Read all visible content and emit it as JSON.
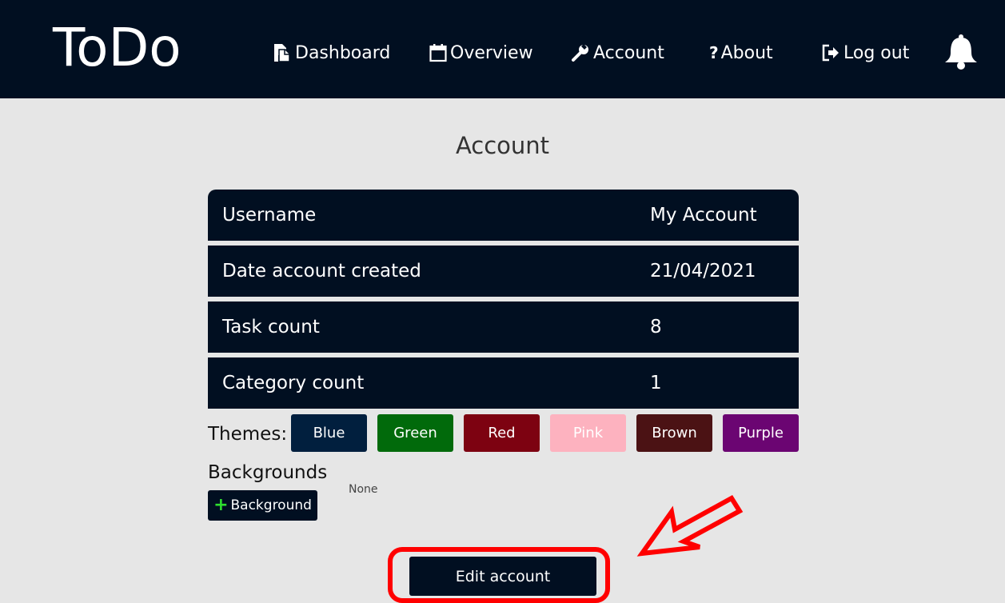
{
  "app": {
    "brand": "ToDo"
  },
  "nav": {
    "items": [
      {
        "label": "Dashboard",
        "icon": "file-copy-icon"
      },
      {
        "label": "Overview",
        "icon": "calendar-icon"
      },
      {
        "label": "Account",
        "icon": "wrench-icon"
      },
      {
        "label": "About",
        "icon": "question-icon"
      },
      {
        "label": "Log out",
        "icon": "logout-icon"
      }
    ],
    "notifications_icon": "bell-icon"
  },
  "page": {
    "title": "Account"
  },
  "account_info": {
    "rows": [
      {
        "label": "Username",
        "value": "My Account"
      },
      {
        "label": "Date account created",
        "value": "21/04/2021"
      },
      {
        "label": "Task count",
        "value": "8"
      },
      {
        "label": "Category count",
        "value": "1"
      }
    ]
  },
  "themes": {
    "label": "Themes:",
    "options": [
      {
        "label": "Blue",
        "color": "#011f3e"
      },
      {
        "label": "Green",
        "color": "#016a0b"
      },
      {
        "label": "Red",
        "color": "#7d0211"
      },
      {
        "label": "Pink",
        "color": "#fdb2bf"
      },
      {
        "label": "Brown",
        "color": "#4b1214"
      },
      {
        "label": "Purple",
        "color": "#6b0572"
      }
    ]
  },
  "backgrounds": {
    "heading": "Backgrounds",
    "empty_text": "None",
    "add_button_label": "Background",
    "add_icon": "plus-icon"
  },
  "actions": {
    "edit_account_label": "Edit account"
  },
  "colors": {
    "navbar": "#010f21",
    "page_background": "#e6e6e6",
    "annotation": "#ff0000"
  }
}
